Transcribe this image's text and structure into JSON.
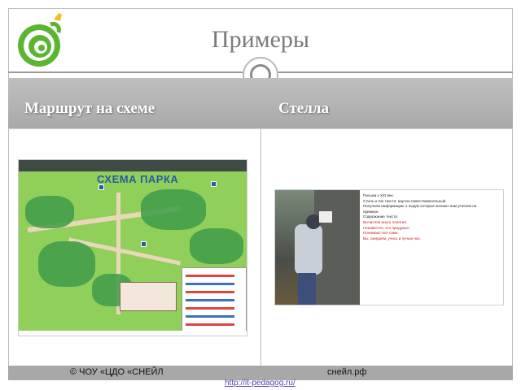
{
  "slide": {
    "title": "Примеры"
  },
  "header": {
    "left_label": "Маршрут на схеме",
    "right_label": "Стелла"
  },
  "map": {
    "title": "СХЕМА ПАРКА"
  },
  "stella": {
    "lines": [
      "Письма к XXI век.",
      "Стиль и тип текста: научно-повествовательный.",
      "Получили информацию о людях которые желают нам успехов на",
      "примере.",
      "Содержание текста:"
    ],
    "red_lines": [
      "Вычисляя иного понятия.",
      "Неизвестно, кто придумал,",
      "Понимают всё сами.",
      "Вы, ожидаем, учись и лучше нас."
    ]
  },
  "footer": {
    "left": "© ЧОУ «ЦДО «СНЕЙЛ",
    "right": "снейл.рф",
    "url": "http://it-pedagog.ru/"
  },
  "colors": {
    "title": "#7a7a7a",
    "header_band": "#b3b3b3",
    "footer_band": "#a8a8a8",
    "logo_green": "#5bb531",
    "link": "#5b3fb0"
  },
  "icons": {
    "logo": "snail-spiral-logo",
    "knob": "ring-ornament-icon"
  }
}
